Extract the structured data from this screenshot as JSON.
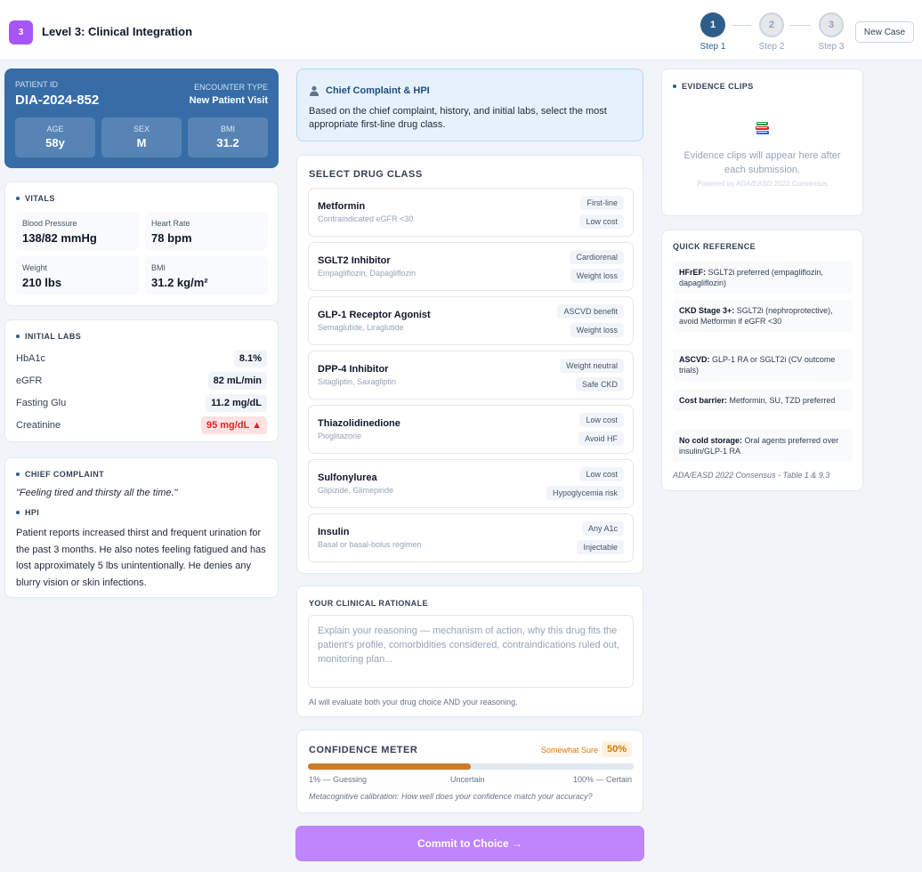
{
  "header": {
    "level_badge": "3",
    "title": "Level 3: Clinical Integration",
    "steps": [
      {
        "num": "1",
        "label": "Step 1",
        "active": true
      },
      {
        "num": "2",
        "label": "Step 2",
        "active": false
      },
      {
        "num": "3",
        "label": "Step 3",
        "active": false
      }
    ],
    "new_case": "New Case"
  },
  "patient": {
    "id_label": "PATIENT ID",
    "id": "DIA-2024-852",
    "encounter_label": "ENCOUNTER TYPE",
    "encounter": "New Patient Visit",
    "stats": [
      {
        "label": "AGE",
        "value": "58y"
      },
      {
        "label": "SEX",
        "value": "M"
      },
      {
        "label": "BMI",
        "value": "31.2"
      }
    ]
  },
  "vitals": {
    "title": "VITALS",
    "items": [
      {
        "label": "Blood Pressure",
        "value": "138/82 mmHg"
      },
      {
        "label": "Heart Rate",
        "value": "78 bpm"
      },
      {
        "label": "Weight",
        "value": "210 lbs"
      },
      {
        "label": "BMI",
        "value": "31.2 kg/m²"
      }
    ]
  },
  "labs": {
    "title": "INITIAL LABS",
    "items": [
      {
        "name": "HbA1c",
        "value": "8.1%",
        "flag": false
      },
      {
        "name": "eGFR",
        "value": "82 mL/min",
        "flag": false
      },
      {
        "name": "Fasting Glu",
        "value": "11.2 mg/dL",
        "flag": false
      },
      {
        "name": "Creatinine",
        "value": "95 mg/dL ▲",
        "flag": true
      }
    ]
  },
  "chief_complaint": {
    "title": "CHIEF COMPLAINT",
    "quote": "\"Feeling tired and thirsty all the time.\"",
    "hpi_title": "HPI",
    "hpi": "Patient reports increased thirst and frequent urination for the past 3 months. He also notes feeling fatigued and has lost approximately 5 lbs unintentionally. He denies any blurry vision or skin infections."
  },
  "prompt_card": {
    "title": "Chief Complaint & HPI",
    "icon": "person-icon",
    "text": "Based on the chief complaint, history, and initial labs, select the most appropriate first-line drug class."
  },
  "drug_select": {
    "title": "SELECT DRUG CLASS",
    "drugs": [
      {
        "name": "Metformin",
        "sub": "Contraindicated eGFR <30",
        "tags": [
          "First-line",
          "Low cost"
        ]
      },
      {
        "name": "SGLT2 Inhibitor",
        "sub": "Empagliflozin, Dapagliflozin",
        "tags": [
          "Cardiorenal",
          "Weight loss"
        ]
      },
      {
        "name": "GLP-1 Receptor Agonist",
        "sub": "Semaglutide, Liraglutide",
        "tags": [
          "ASCVD benefit",
          "Weight loss"
        ]
      },
      {
        "name": "DPP-4 Inhibitor",
        "sub": "Sitagliptin, Saxagliptin",
        "tags": [
          "Weight neutral",
          "Safe CKD"
        ]
      },
      {
        "name": "Thiazolidinedione",
        "sub": "Pioglitazone",
        "tags": [
          "Low cost",
          "Avoid HF"
        ]
      },
      {
        "name": "Sulfonylurea",
        "sub": "Glipizide, Glimepiride",
        "tags": [
          "Low cost",
          "Hypoglycemia risk"
        ]
      },
      {
        "name": "Insulin",
        "sub": "Basal or basal-bolus regimen",
        "tags": [
          "Any A1c",
          "Injectable"
        ]
      }
    ]
  },
  "rationale": {
    "title": "YOUR CLINICAL RATIONALE",
    "placeholder": "Explain your reasoning — mechanism of action, why this drug fits the patient's profile, comorbidities considered, contraindications ruled out, monitoring plan...",
    "note": "AI will evaluate both your drug choice AND your reasoning."
  },
  "confidence": {
    "title": "CONFIDENCE METER",
    "state": "Somewhat Sure",
    "value_label": "50%",
    "value": 0.5,
    "scale": [
      "1% — Guessing",
      "Uncertain",
      "100% — Certain"
    ],
    "meta": "Metacognitive calibration: How well does your confidence match your accuracy?"
  },
  "commit": {
    "label": "Commit to Choice →"
  },
  "evidence": {
    "title": "EVIDENCE CLIPS",
    "icon": "books-icon",
    "message": "Evidence clips will appear here after each submission.",
    "powered": "Powered by ADA/EASD 2022 Consensus"
  },
  "quick_reference": {
    "title": "QUICK REFERENCE",
    "items": [
      {
        "bold": "HFrEF:",
        "text": " SGLT2i preferred (empagliflozin, dapagliflozin)"
      },
      {
        "bold": "CKD Stage 3+:",
        "text": " SGLT2i (nephroprotective), avoid Metformin if eGFR <30"
      },
      {
        "bold": "ASCVD:",
        "text": " GLP-1 RA or SGLT2i (CV outcome trials)"
      },
      {
        "bold": "Cost barrier:",
        "text": " Metformin, SU, TZD preferred"
      },
      {
        "bold": "No cold storage:",
        "text": " Oral agents preferred over insulin/GLP-1 RA"
      }
    ],
    "source": "ADA/EASD 2022 Consensus - Table 1 & 9.3"
  },
  "colors": {
    "accent": "#2f5d8a",
    "patient_card": "#376da6",
    "badge": "#a855f7",
    "commit": "#c084fc",
    "confidence_fill": "#c97c2a",
    "danger": "#dc2626"
  }
}
